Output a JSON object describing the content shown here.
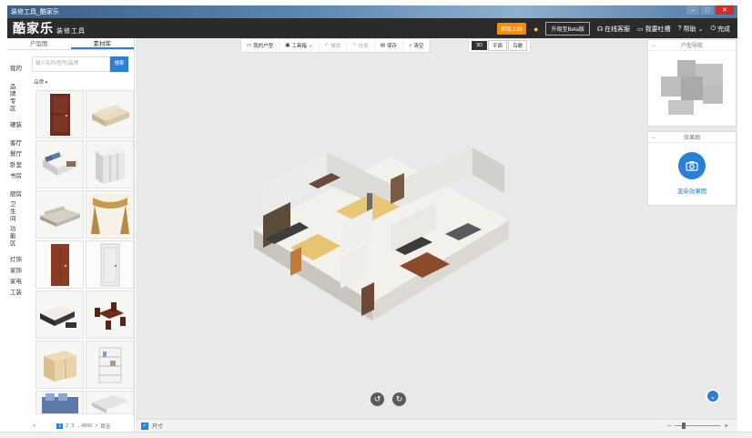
{
  "window": {
    "title": "装修工具_酷家乐"
  },
  "header": {
    "logo": "酷家乐",
    "logo_sub": "装修工具",
    "new_badge": "新版上线",
    "upgrade_label": "升级至Beta版",
    "online_service": "在线客服",
    "share": "我要吐槽",
    "help": "帮助",
    "finish": "完成"
  },
  "left": {
    "tabs": [
      "户型图",
      "素材库"
    ],
    "categories": [
      "我的",
      "品牌专区",
      "硬装",
      "客厅",
      "餐厅",
      "卧室",
      "书房",
      "厨房",
      "卫生间",
      "功能区",
      "灯饰",
      "家饰",
      "家电",
      "工装"
    ],
    "search_placeholder": "输入名称/型号/品牌",
    "search_button": "搜索",
    "brand_filter": "品牌",
    "pagination": {
      "current": "1",
      "p2": "2",
      "p3": "3",
      "ellipsis": "...4890",
      "next": ">",
      "jump": "跳至"
    }
  },
  "toolbar": {
    "items": [
      "我的户型",
      "工具箱",
      "撤销",
      "恢复",
      "保存",
      "清空"
    ],
    "view_modes": [
      "3D",
      "平面",
      "鸟瞰"
    ]
  },
  "right": {
    "floorplan_title": "户型导航",
    "render_title": "效果图",
    "render_button": "渲染效果图"
  },
  "bottom": {
    "dimension_label": "尺寸",
    "zoom_minus": "−",
    "zoom_plus": "+"
  },
  "colors": {
    "accent": "#2a7fd8",
    "header_bg": "#2b2b2b",
    "badge": "#ff8a00"
  }
}
